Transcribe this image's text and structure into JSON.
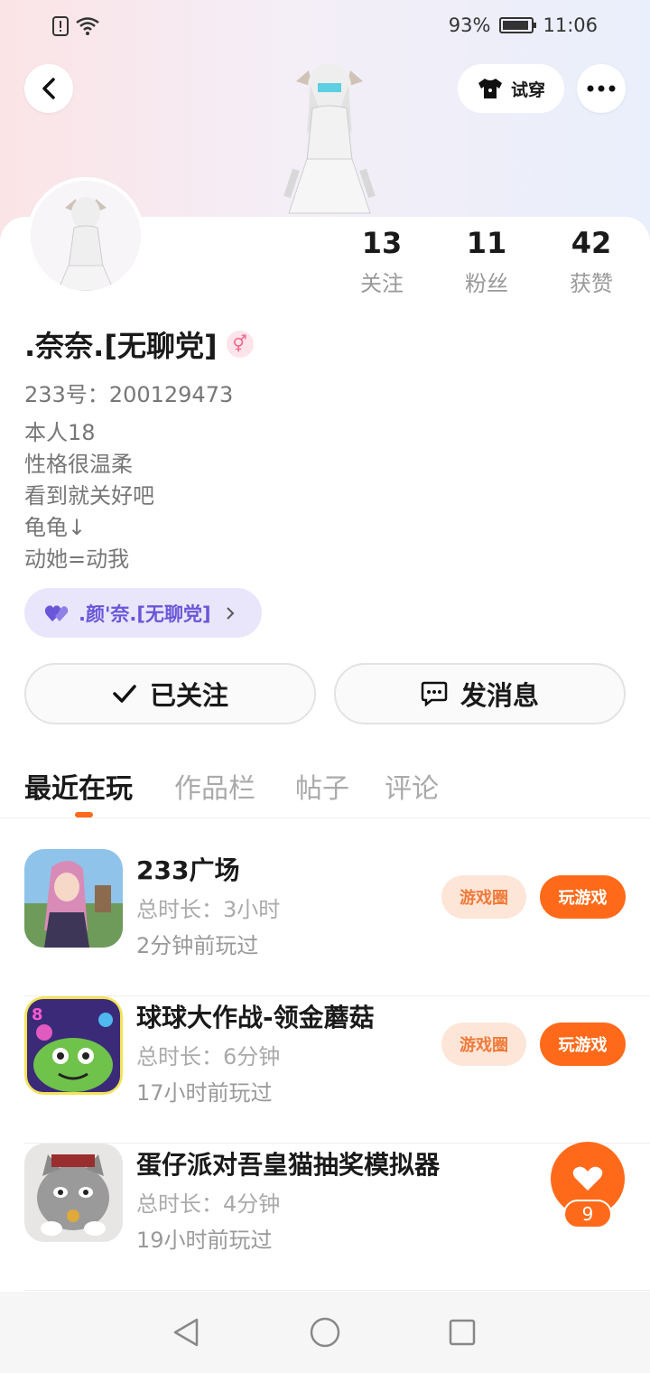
{
  "status_bar": {
    "battery": "93%",
    "time": "11:06"
  },
  "header": {
    "try_on_label": "试穿"
  },
  "profile": {
    "stats": [
      {
        "value": "13",
        "label": "关注"
      },
      {
        "value": "11",
        "label": "粉丝"
      },
      {
        "value": "42",
        "label": "获赞"
      }
    ],
    "name": ".奈奈.[无聊党]",
    "gender_symbol": "⚥",
    "uid": "233号：200129473",
    "bio": [
      "本人18",
      "性格很温柔",
      "看到就关好吧",
      "龟龟↓",
      "动她=动我"
    ],
    "cp_label": ".颜'奈.[无聊党]",
    "follow_label": "已关注",
    "message_label": "发消息"
  },
  "tabs": [
    "最近在玩",
    "作品栏",
    "帖子",
    "评论"
  ],
  "games": [
    {
      "title": "233广场",
      "duration": "总时长：3小时",
      "last_played": "2分钟前玩过",
      "circle_label": "游戏圈",
      "play_label": "玩游戏"
    },
    {
      "title": "球球大作战-领金蘑菇",
      "duration": "总时长：6分钟",
      "last_played": "17小时前玩过",
      "circle_label": "游戏圈",
      "play_label": "玩游戏"
    },
    {
      "title": "蛋仔派对吾皇猫抽奖模拟器",
      "duration": "总时长：4分钟",
      "last_played": "19小时前玩过"
    }
  ],
  "like_float": {
    "count": "9"
  },
  "colors": {
    "accent": "#ff6a1a",
    "cp_purple": "#6a56d8"
  }
}
